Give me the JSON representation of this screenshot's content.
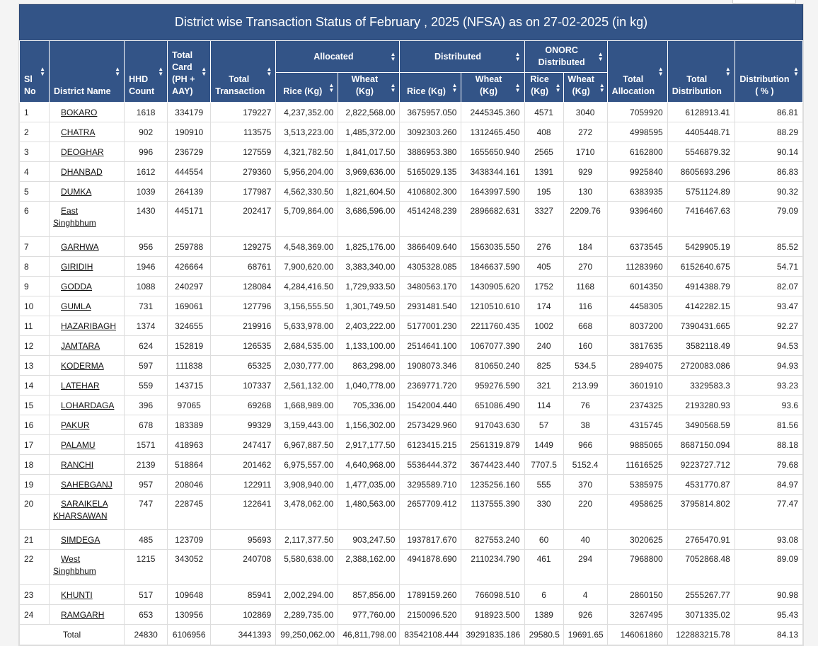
{
  "page": {
    "title": "District wise Transaction Status of February , 2025 (NFSA) as on 27-02-2025 (in kg)"
  },
  "icons": {
    "sort": "sort-both-icon"
  },
  "colors": {
    "header_bg": "#335487",
    "header_text": "#ffffff"
  },
  "headers": {
    "sl_no": "Sl No",
    "district": "District Name",
    "hhd": "HHD Count",
    "total_card": "Total Card (PH + AAY)",
    "total_txn": "Total Transaction",
    "allocated": "Allocated",
    "distributed": "Distributed",
    "onorc": "ONORC Distributed",
    "total_alloc": "Total Allocation",
    "total_dist": "Total Distribution",
    "dist_pct": "Distribution ( % )",
    "rice": "Rice (Kg)",
    "wheat": "Wheat (Kg)"
  },
  "rows": [
    {
      "sl": "1",
      "district": "BOKARO",
      "hhd": "1618",
      "cards": "334179",
      "txn": "179227",
      "alloc_rice": "4,237,352.00",
      "alloc_wheat": "2,822,568.00",
      "dist_rice": "3675957.050",
      "dist_wheat": "2445345.360",
      "onorc_rice": "4571",
      "onorc_wheat": "3040",
      "total_alloc": "7059920",
      "total_dist": "6128913.41",
      "pct": "86.81"
    },
    {
      "sl": "2",
      "district": "CHATRA",
      "hhd": "902",
      "cards": "190910",
      "txn": "113575",
      "alloc_rice": "3,513,223.00",
      "alloc_wheat": "1,485,372.00",
      "dist_rice": "3092303.260",
      "dist_wheat": "1312465.450",
      "onorc_rice": "408",
      "onorc_wheat": "272",
      "total_alloc": "4998595",
      "total_dist": "4405448.71",
      "pct": "88.29"
    },
    {
      "sl": "3",
      "district": "DEOGHAR",
      "hhd": "996",
      "cards": "236729",
      "txn": "127559",
      "alloc_rice": "4,321,782.50",
      "alloc_wheat": "1,841,017.50",
      "dist_rice": "3886953.380",
      "dist_wheat": "1655650.940",
      "onorc_rice": "2565",
      "onorc_wheat": "1710",
      "total_alloc": "6162800",
      "total_dist": "5546879.32",
      "pct": "90.14"
    },
    {
      "sl": "4",
      "district": "DHANBAD",
      "hhd": "1612",
      "cards": "444554",
      "txn": "279360",
      "alloc_rice": "5,956,204.00",
      "alloc_wheat": "3,969,636.00",
      "dist_rice": "5165029.135",
      "dist_wheat": "3438344.161",
      "onorc_rice": "1391",
      "onorc_wheat": "929",
      "total_alloc": "9925840",
      "total_dist": "8605693.296",
      "pct": "86.83"
    },
    {
      "sl": "5",
      "district": "DUMKA",
      "hhd": "1039",
      "cards": "264139",
      "txn": "177987",
      "alloc_rice": "4,562,330.50",
      "alloc_wheat": "1,821,604.50",
      "dist_rice": "4106802.300",
      "dist_wheat": "1643997.590",
      "onorc_rice": "195",
      "onorc_wheat": "130",
      "total_alloc": "6383935",
      "total_dist": "5751124.89",
      "pct": "90.32"
    },
    {
      "sl": "6",
      "district_l1": "East",
      "district_l2": "Singhbhum",
      "hhd": "1430",
      "cards": "445171",
      "txn": "202417",
      "alloc_rice": "5,709,864.00",
      "alloc_wheat": "3,686,596.00",
      "dist_rice": "4514248.239",
      "dist_wheat": "2896682.631",
      "onorc_rice": "3327",
      "onorc_wheat": "2209.76",
      "total_alloc": "9396460",
      "total_dist": "7416467.63",
      "pct": "79.09"
    },
    {
      "sl": "7",
      "district": "GARHWA",
      "hhd": "956",
      "cards": "259788",
      "txn": "129275",
      "alloc_rice": "4,548,369.00",
      "alloc_wheat": "1,825,176.00",
      "dist_rice": "3866409.640",
      "dist_wheat": "1563035.550",
      "onorc_rice": "276",
      "onorc_wheat": "184",
      "total_alloc": "6373545",
      "total_dist": "5429905.19",
      "pct": "85.52"
    },
    {
      "sl": "8",
      "district": "GIRIDIH",
      "hhd": "1946",
      "cards": "426664",
      "txn": "68761",
      "alloc_rice": "7,900,620.00",
      "alloc_wheat": "3,383,340.00",
      "dist_rice": "4305328.085",
      "dist_wheat": "1846637.590",
      "onorc_rice": "405",
      "onorc_wheat": "270",
      "total_alloc": "11283960",
      "total_dist": "6152640.675",
      "pct": "54.71"
    },
    {
      "sl": "9",
      "district": "GODDA",
      "hhd": "1088",
      "cards": "240297",
      "txn": "128084",
      "alloc_rice": "4,284,416.50",
      "alloc_wheat": "1,729,933.50",
      "dist_rice": "3480563.170",
      "dist_wheat": "1430905.620",
      "onorc_rice": "1752",
      "onorc_wheat": "1168",
      "total_alloc": "6014350",
      "total_dist": "4914388.79",
      "pct": "82.07"
    },
    {
      "sl": "10",
      "district": "GUMLA",
      "hhd": "731",
      "cards": "169061",
      "txn": "127796",
      "alloc_rice": "3,156,555.50",
      "alloc_wheat": "1,301,749.50",
      "dist_rice": "2931481.540",
      "dist_wheat": "1210510.610",
      "onorc_rice": "174",
      "onorc_wheat": "116",
      "total_alloc": "4458305",
      "total_dist": "4142282.15",
      "pct": "93.47"
    },
    {
      "sl": "11",
      "district": "HAZARIBAGH",
      "hhd": "1374",
      "cards": "324655",
      "txn": "219916",
      "alloc_rice": "5,633,978.00",
      "alloc_wheat": "2,403,222.00",
      "dist_rice": "5177001.230",
      "dist_wheat": "2211760.435",
      "onorc_rice": "1002",
      "onorc_wheat": "668",
      "total_alloc": "8037200",
      "total_dist": "7390431.665",
      "pct": "92.27"
    },
    {
      "sl": "12",
      "district": "JAMTARA",
      "hhd": "624",
      "cards": "152819",
      "txn": "126535",
      "alloc_rice": "2,684,535.00",
      "alloc_wheat": "1,133,100.00",
      "dist_rice": "2514641.100",
      "dist_wheat": "1067077.390",
      "onorc_rice": "240",
      "onorc_wheat": "160",
      "total_alloc": "3817635",
      "total_dist": "3582118.49",
      "pct": "94.53"
    },
    {
      "sl": "13",
      "district": "KODERMA",
      "hhd": "597",
      "cards": "111838",
      "txn": "65325",
      "alloc_rice": "2,030,777.00",
      "alloc_wheat": "863,298.00",
      "dist_rice": "1908073.346",
      "dist_wheat": "810650.240",
      "onorc_rice": "825",
      "onorc_wheat": "534.5",
      "total_alloc": "2894075",
      "total_dist": "2720083.086",
      "pct": "94.93"
    },
    {
      "sl": "14",
      "district": "LATEHAR",
      "hhd": "559",
      "cards": "143715",
      "txn": "107337",
      "alloc_rice": "2,561,132.00",
      "alloc_wheat": "1,040,778.00",
      "dist_rice": "2369771.720",
      "dist_wheat": "959276.590",
      "onorc_rice": "321",
      "onorc_wheat": "213.99",
      "total_alloc": "3601910",
      "total_dist": "3329583.3",
      "pct": "93.23"
    },
    {
      "sl": "15",
      "district": "LOHARDAGA",
      "hhd": "396",
      "cards": "97065",
      "txn": "69268",
      "alloc_rice": "1,668,989.00",
      "alloc_wheat": "705,336.00",
      "dist_rice": "1542004.440",
      "dist_wheat": "651086.490",
      "onorc_rice": "114",
      "onorc_wheat": "76",
      "total_alloc": "2374325",
      "total_dist": "2193280.93",
      "pct": "93.6"
    },
    {
      "sl": "16",
      "district": "PAKUR",
      "hhd": "678",
      "cards": "183389",
      "txn": "99329",
      "alloc_rice": "3,159,443.00",
      "alloc_wheat": "1,156,302.00",
      "dist_rice": "2573429.960",
      "dist_wheat": "917043.630",
      "onorc_rice": "57",
      "onorc_wheat": "38",
      "total_alloc": "4315745",
      "total_dist": "3490568.59",
      "pct": "81.56"
    },
    {
      "sl": "17",
      "district": "PALAMU",
      "hhd": "1571",
      "cards": "418963",
      "txn": "247417",
      "alloc_rice": "6,967,887.50",
      "alloc_wheat": "2,917,177.50",
      "dist_rice": "6123415.215",
      "dist_wheat": "2561319.879",
      "onorc_rice": "1449",
      "onorc_wheat": "966",
      "total_alloc": "9885065",
      "total_dist": "8687150.094",
      "pct": "88.18"
    },
    {
      "sl": "18",
      "district": "RANCHI",
      "hhd": "2139",
      "cards": "518864",
      "txn": "201462",
      "alloc_rice": "6,975,557.00",
      "alloc_wheat": "4,640,968.00",
      "dist_rice": "5536444.372",
      "dist_wheat": "3674423.440",
      "onorc_rice": "7707.5",
      "onorc_wheat": "5152.4",
      "total_alloc": "11616525",
      "total_dist": "9223727.712",
      "pct": "79.68"
    },
    {
      "sl": "19",
      "district": "SAHEBGANJ",
      "hhd": "957",
      "cards": "208046",
      "txn": "122911",
      "alloc_rice": "3,908,940.00",
      "alloc_wheat": "1,477,035.00",
      "dist_rice": "3295589.710",
      "dist_wheat": "1235256.160",
      "onorc_rice": "555",
      "onorc_wheat": "370",
      "total_alloc": "5385975",
      "total_dist": "4531770.87",
      "pct": "84.97"
    },
    {
      "sl": "20",
      "district_l1": "SARAIKELA",
      "district_l2": "KHARSAWAN",
      "hhd": "747",
      "cards": "228745",
      "txn": "122641",
      "alloc_rice": "3,478,062.00",
      "alloc_wheat": "1,480,563.00",
      "dist_rice": "2657709.412",
      "dist_wheat": "1137555.390",
      "onorc_rice": "330",
      "onorc_wheat": "220",
      "total_alloc": "4958625",
      "total_dist": "3795814.802",
      "pct": "77.47"
    },
    {
      "sl": "21",
      "district": "SIMDEGA",
      "hhd": "485",
      "cards": "123709",
      "txn": "95693",
      "alloc_rice": "2,117,377.50",
      "alloc_wheat": "903,247.50",
      "dist_rice": "1937817.670",
      "dist_wheat": "827553.240",
      "onorc_rice": "60",
      "onorc_wheat": "40",
      "total_alloc": "3020625",
      "total_dist": "2765470.91",
      "pct": "93.08"
    },
    {
      "sl": "22",
      "district_l1": "West",
      "district_l2": "Singhbhum",
      "hhd": "1215",
      "cards": "343052",
      "txn": "240708",
      "alloc_rice": "5,580,638.00",
      "alloc_wheat": "2,388,162.00",
      "dist_rice": "4941878.690",
      "dist_wheat": "2110234.790",
      "onorc_rice": "461",
      "onorc_wheat": "294",
      "total_alloc": "7968800",
      "total_dist": "7052868.48",
      "pct": "89.09"
    },
    {
      "sl": "23",
      "district": "KHUNTI",
      "hhd": "517",
      "cards": "109648",
      "txn": "85941",
      "alloc_rice": "2,002,294.00",
      "alloc_wheat": "857,856.00",
      "dist_rice": "1789159.260",
      "dist_wheat": "766098.510",
      "onorc_rice": "6",
      "onorc_wheat": "4",
      "total_alloc": "2860150",
      "total_dist": "2555267.77",
      "pct": "90.98"
    },
    {
      "sl": "24",
      "district": "RAMGARH",
      "hhd": "653",
      "cards": "130956",
      "txn": "102869",
      "alloc_rice": "2,289,735.00",
      "alloc_wheat": "977,760.00",
      "dist_rice": "2150096.520",
      "dist_wheat": "918923.500",
      "onorc_rice": "1389",
      "onorc_wheat": "926",
      "total_alloc": "3267495",
      "total_dist": "3071335.02",
      "pct": "95.43"
    }
  ],
  "total": {
    "label": "Total",
    "hhd": "24830",
    "cards": "6106956",
    "txn": "3441393",
    "alloc_rice": "99,250,062.00",
    "alloc_wheat": "46,811,798.00",
    "dist_rice": "83542108.444",
    "dist_wheat": "39291835.186",
    "onorc_rice": "29580.5",
    "onorc_wheat": "19691.65",
    "total_alloc": "146061860",
    "total_dist": "122883215.78",
    "pct": "84.13"
  }
}
